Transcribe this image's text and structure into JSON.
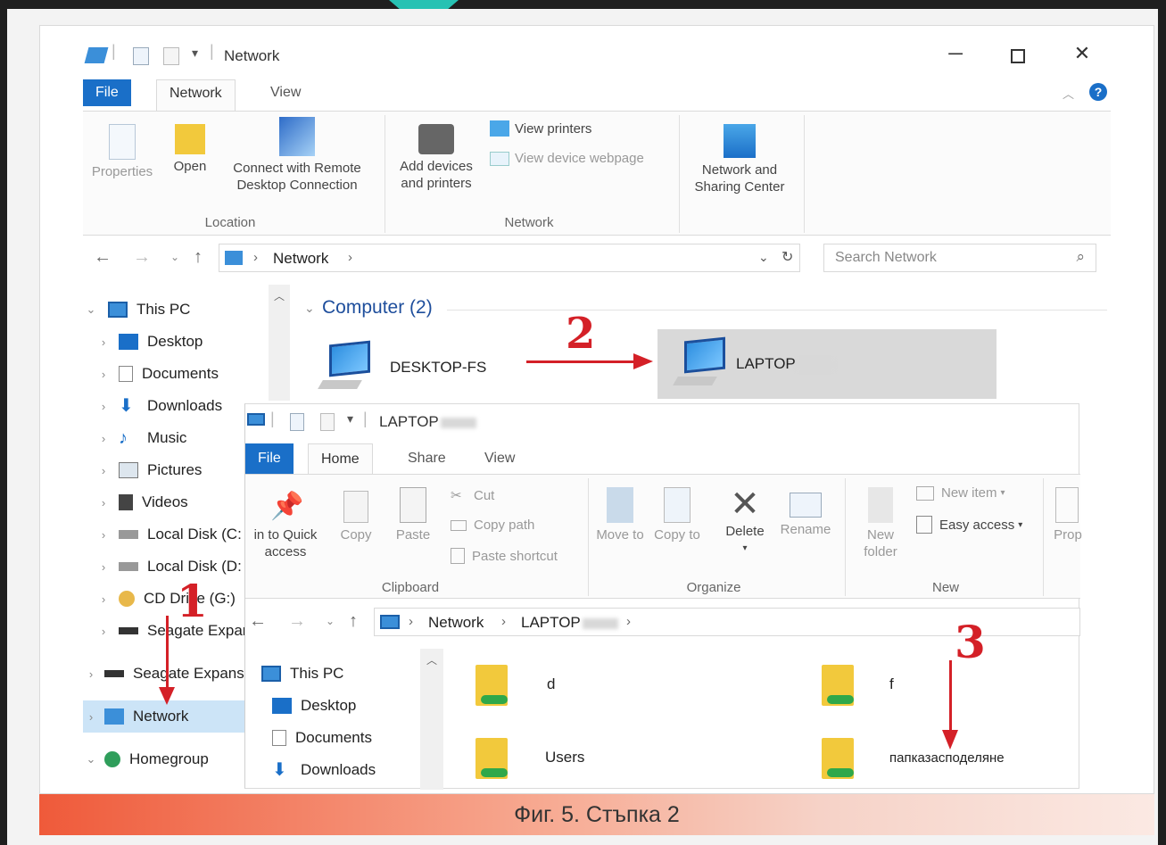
{
  "window1": {
    "title": "Network",
    "tabs": [
      "File",
      "Network",
      "View"
    ],
    "ribbon": {
      "properties": "Properties",
      "open": "Open",
      "connect_remote": "Connect with Remote Desktop Connection",
      "group_location": "Location",
      "add_devices": "Add devices and printers",
      "view_printers": "View printers",
      "view_device_webpage": "View device webpage",
      "group_network": "Network",
      "network_sharing": "Network and Sharing Center"
    },
    "address": {
      "crumbs": [
        "Network"
      ],
      "search_placeholder": "Search Network"
    },
    "nav": [
      "This PC",
      "Desktop",
      "Documents",
      "Downloads",
      "Music",
      "Pictures",
      "Videos",
      "Local Disk (C:",
      "Local Disk (D:",
      "CD Drive (G:)",
      "Seagate Expar",
      "Seagate Expans",
      "Network",
      "Homegroup"
    ],
    "group_header": "Computer (2)",
    "computers": [
      "DESKTOP-FS",
      "LAPTOP"
    ]
  },
  "window2": {
    "title": "LAPTOP",
    "tabs": [
      "File",
      "Home",
      "Share",
      "View"
    ],
    "ribbon": {
      "pin_quick": "in to Quick access",
      "copy": "Copy",
      "paste": "Paste",
      "cut": "Cut",
      "copy_path": "Copy path",
      "paste_shortcut": "Paste shortcut",
      "group_clipboard": "Clipboard",
      "move_to": "Move to",
      "copy_to": "Copy to",
      "delete": "Delete",
      "rename": "Rename",
      "group_organize": "Organize",
      "new_folder": "New folder",
      "new_item": "New item",
      "easy_access": "Easy access",
      "group_new": "New",
      "properties": "Prop"
    },
    "address": {
      "crumbs": [
        "Network",
        "LAPTOP"
      ]
    },
    "nav": [
      "This PC",
      "Desktop",
      "Documents",
      "Downloads"
    ],
    "folders": [
      "d",
      "f",
      "Users",
      "папказасподеляне"
    ]
  },
  "annotations": {
    "n1": "1",
    "n2": "2",
    "n3": "3"
  },
  "caption": "Фиг. 5. Стъпка 2",
  "colors": {
    "accent": "#1a6fc8",
    "annotation": "#d42027"
  }
}
